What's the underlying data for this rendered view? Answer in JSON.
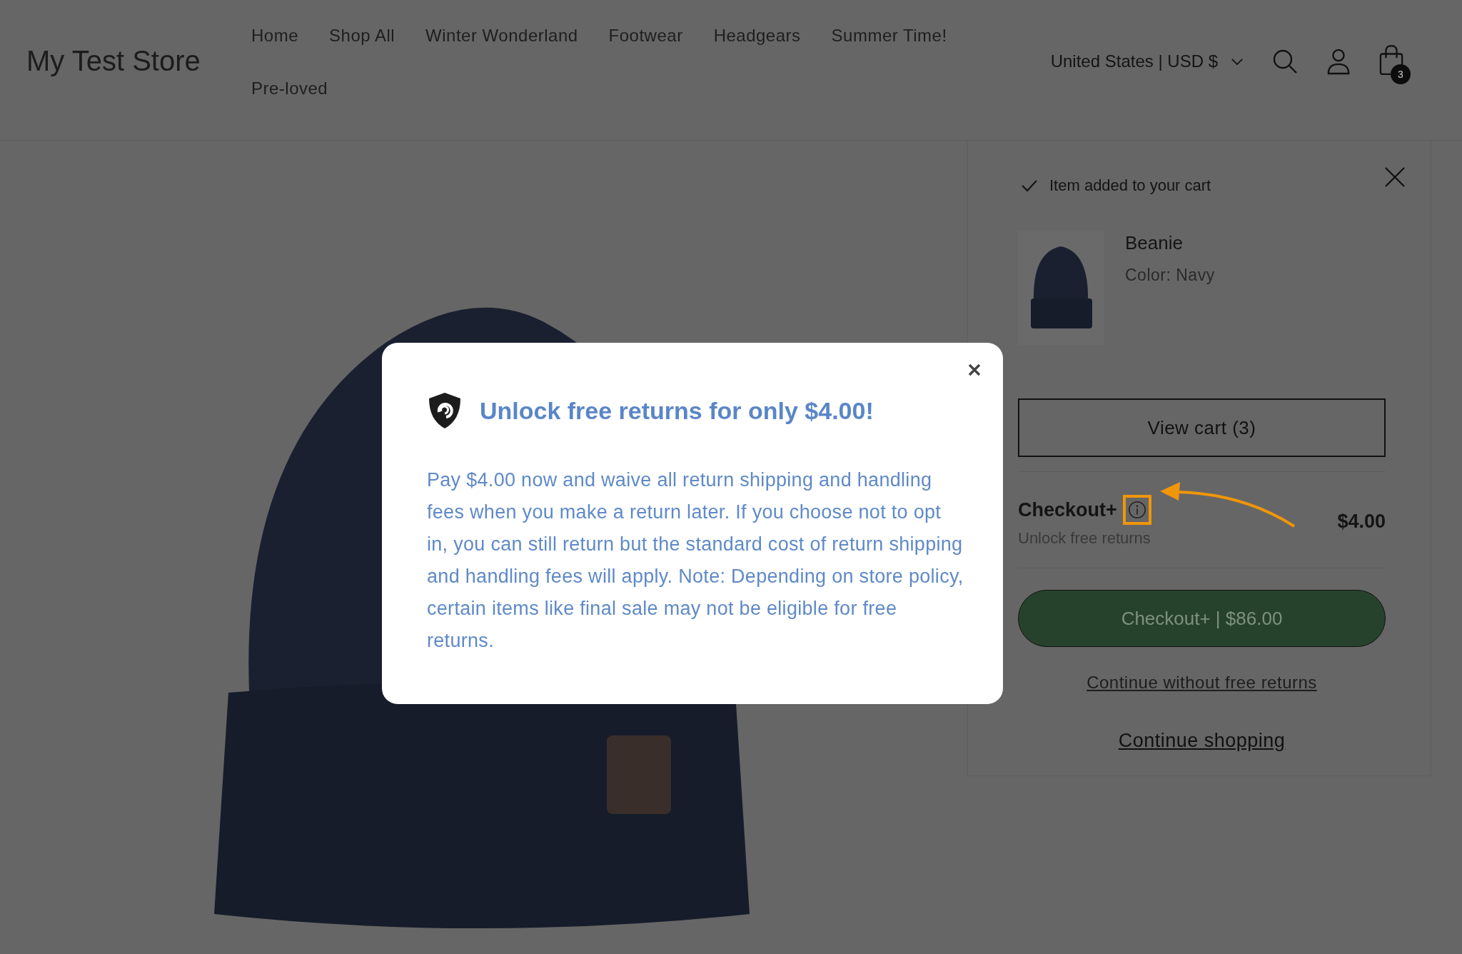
{
  "store_name": "My Test Store",
  "nav": [
    "Home",
    "Shop All",
    "Winter Wonderland",
    "Footwear",
    "Headgears",
    "Summer Time!",
    "Pre-loved"
  ],
  "locale_selector": "United States | USD $",
  "cart_count": "3",
  "cart_drawer": {
    "notice": "Item added to your cart",
    "item": {
      "name": "Beanie",
      "option": "Color: Navy"
    },
    "view_cart": "View cart (3)",
    "protection": {
      "title": "Checkout+",
      "subtitle": "Unlock free returns",
      "price": "$4.00"
    },
    "checkout_button": "Checkout+ | $86.00",
    "decline_link": "Continue without free returns",
    "continue_link": "Continue shopping"
  },
  "modal": {
    "title": "Unlock free returns for only $4.00!",
    "body": "Pay $4.00 now and waive all return shipping and handling fees when you make a return later. If you choose not to opt in, you can still return but the standard cost of return shipping and handling fees will apply. Note: Depending on store policy, certain items like final sale may not be eligible for free returns."
  }
}
